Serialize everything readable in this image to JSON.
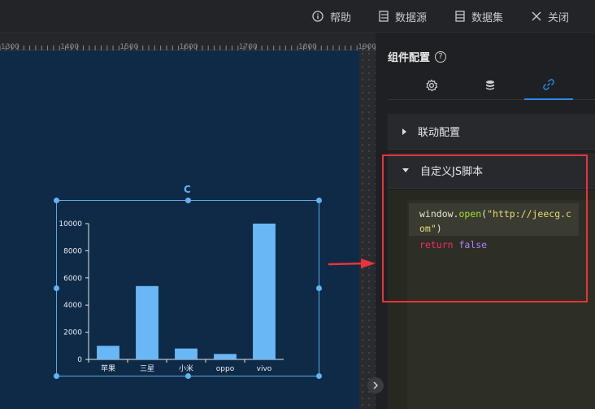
{
  "toolbar": {
    "help": "帮助",
    "datasource": "数据源",
    "dataset": "数据集",
    "close": "关闭"
  },
  "ruler": {
    "ticks": [
      "1300",
      "1400",
      "1500",
      "1600",
      "1700",
      "1800",
      "1900"
    ]
  },
  "panel": {
    "title": "组件配置",
    "help_glyph": "?",
    "tabs": [
      {
        "icon": "gear-icon"
      },
      {
        "icon": "database-icon"
      },
      {
        "icon": "link-icon",
        "active": true
      }
    ],
    "sections": [
      {
        "label": "联动配置",
        "expanded": false
      },
      {
        "label": "自定义JS脚本",
        "expanded": true
      }
    ],
    "code": {
      "line1_a": "window.",
      "line1_b": "open",
      "line1_c": "(",
      "line1_d": "\"http://jeecg.c",
      "line2_a": "om\"",
      "line2_b": ")",
      "line3_a": "return",
      "line3_b": " false"
    }
  },
  "widget": {
    "refresh_glyph": "C"
  },
  "colors": {
    "accent": "#2b8ae8",
    "bar": "#69b8f5",
    "highlight": "#e8343a",
    "canvas": "#0f2a47"
  },
  "chart_data": {
    "type": "bar",
    "categories": [
      "苹果",
      "三星",
      "小米",
      "oppo",
      "vivo"
    ],
    "values": [
      1000,
      5400,
      800,
      400,
      10000
    ],
    "yticks": [
      "0",
      "2000",
      "4000",
      "6000",
      "8000",
      "10000"
    ],
    "ylim": [
      0,
      10000
    ],
    "grid": false
  }
}
